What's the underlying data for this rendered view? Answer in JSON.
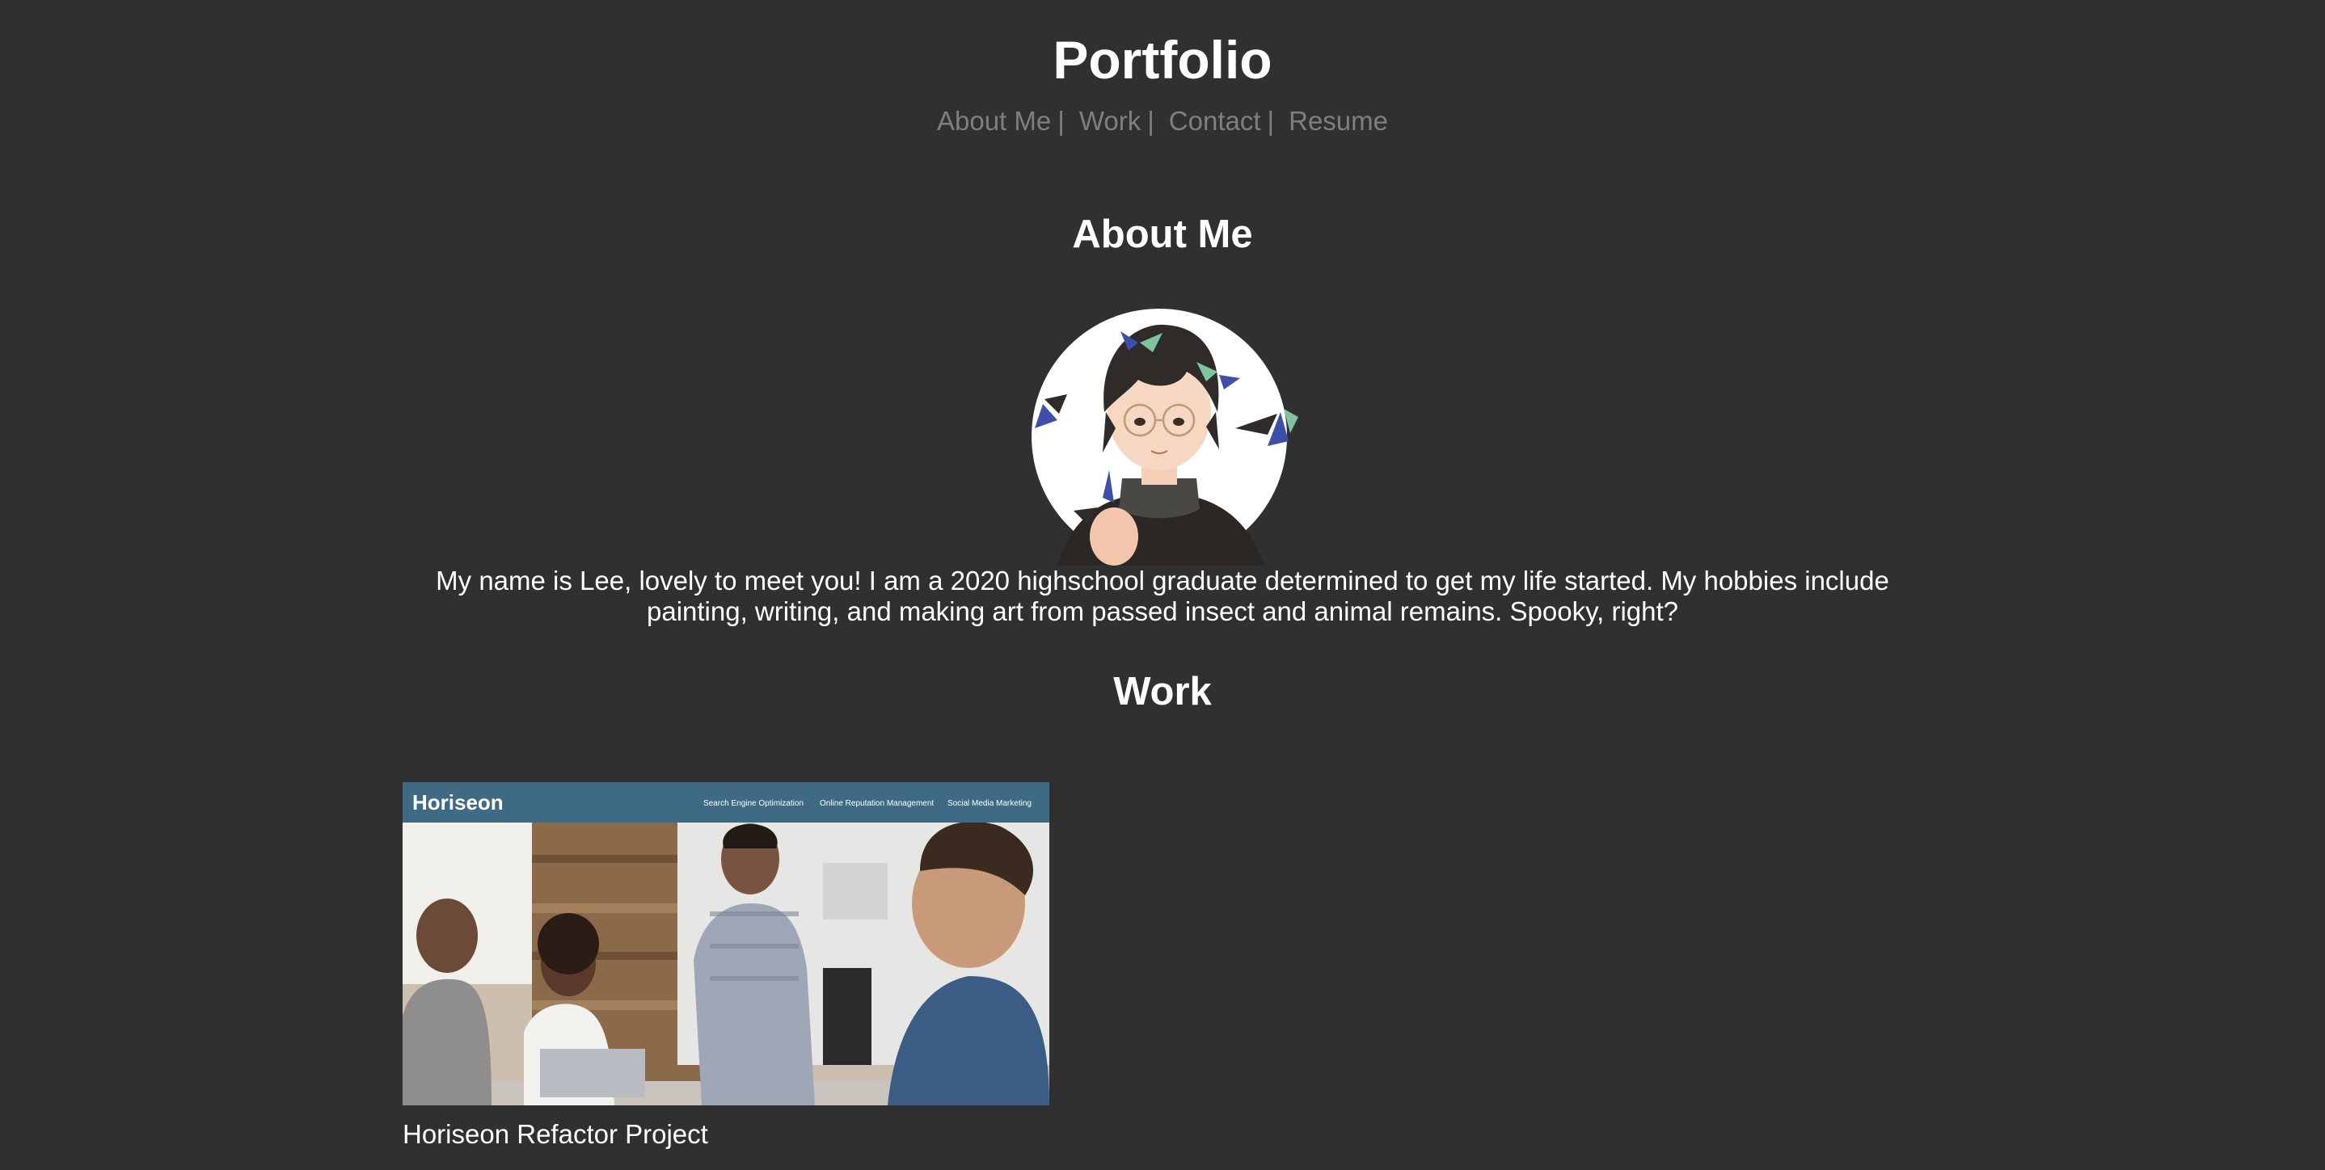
{
  "header": {
    "title": "Portfolio",
    "nav": [
      {
        "label": "About Me",
        "sep": "|"
      },
      {
        "label": "Work",
        "sep": "|"
      },
      {
        "label": "Contact",
        "sep": "|"
      },
      {
        "label": "Resume"
      }
    ]
  },
  "about": {
    "title": "About Me",
    "avatar_icon": "avatar-illustration",
    "text": "My name is Lee, lovely to meet you! I am a 2020 highschool graduate determined to get my life started. My hobbies include painting, writing, and making art from passed insect and animal remains. Spooky, right?"
  },
  "work": {
    "title": "Work",
    "projects": [
      {
        "caption": "Horiseon Refactor Project",
        "thumbnail": {
          "brand": "Horiseon",
          "nav": [
            "Search Engine Optimization",
            "Online Reputation Management",
            "Social Media Marketing"
          ],
          "header_color": "#3e6a84"
        }
      }
    ]
  },
  "colors": {
    "background": "#303030",
    "text": "#ffffff",
    "nav_text": "#7f7f7f"
  }
}
